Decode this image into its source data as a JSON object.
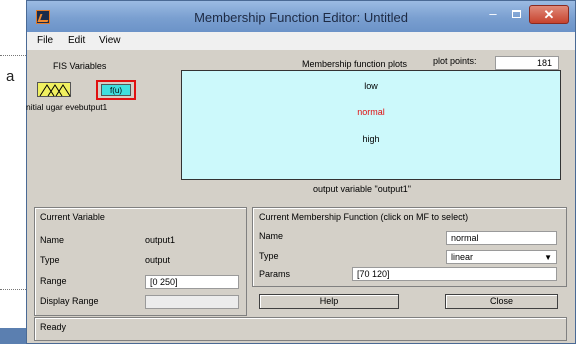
{
  "window": {
    "title": "Membership Function Editor: Untitled"
  },
  "titlebar_controls": {
    "minimize": "–",
    "close": "✕"
  },
  "menu": {
    "items": [
      "File",
      "Edit",
      "View"
    ]
  },
  "fis": {
    "heading": "FIS Variables",
    "output_label": "f(u)",
    "caption": "nitial ugar evebutput1"
  },
  "plot": {
    "heading": "Membership function plots",
    "points_label": "plot points:",
    "points_value": "181",
    "mfs": [
      "low",
      "normal",
      "high"
    ],
    "selected_color": "#e01010",
    "caption": "output variable \"output1\""
  },
  "current_variable": {
    "heading": "Current Variable",
    "name_label": "Name",
    "name_value": "output1",
    "type_label": "Type",
    "type_value": "output",
    "range_label": "Range",
    "range_value": "[0 250]",
    "display_range_label": "Display Range",
    "display_range_value": ""
  },
  "current_mf": {
    "heading": "Current Membership Function (click on MF to select)",
    "name_label": "Name",
    "name_value": "normal",
    "type_label": "Type",
    "type_value": "linear",
    "params_label": "Params",
    "params_value": "[70 120]"
  },
  "buttons": {
    "help": "Help",
    "close": "Close"
  },
  "status": {
    "text": "Ready"
  },
  "background": {
    "fragment_letter": "a"
  },
  "colors": {
    "plot_bg": "#ccf9fb",
    "input_mf": "#f0f060",
    "output_var": "#40e0e0",
    "highlight": "#e01010"
  }
}
